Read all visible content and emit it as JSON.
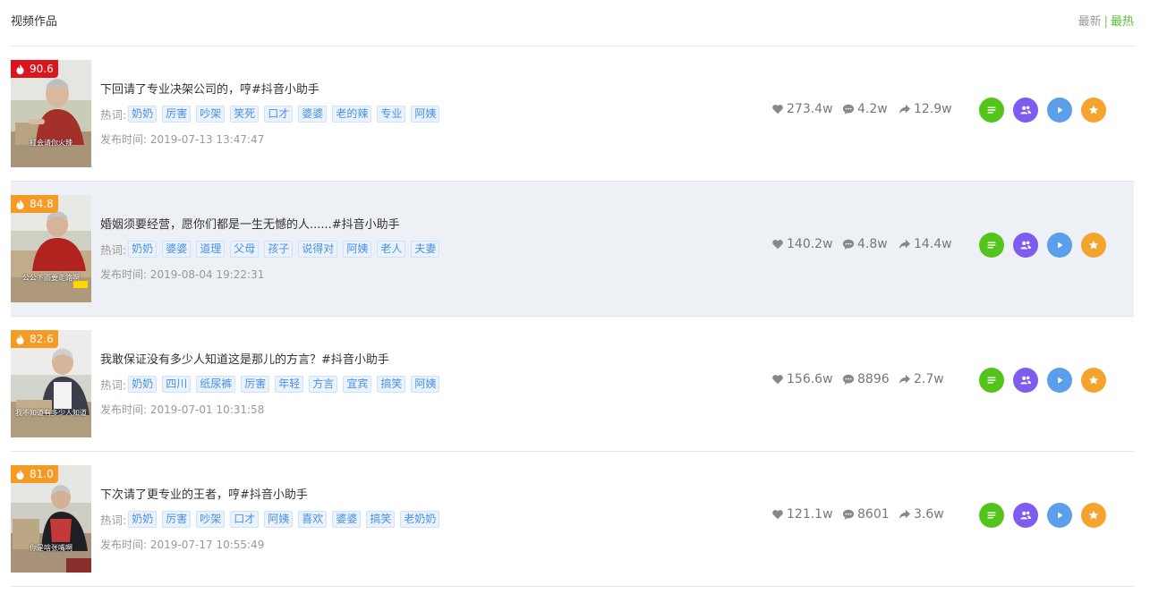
{
  "header": {
    "title": "视频作品",
    "sort_newest": "最新",
    "sort_separator": "|",
    "sort_hottest": "最热"
  },
  "tags_label": "热词:",
  "time_label": "发布时间:",
  "colors": {
    "badge_red": "#d9161e",
    "badge_orange": "#f59a23",
    "active_sort": "#5cba2d",
    "tag_text": "#4a90e2"
  },
  "videos": [
    {
      "score": "90.6",
      "title": "下回请了专业决架公司的，哼#抖音小助手",
      "tags": [
        "奶奶",
        "厉害",
        "吵架",
        "笑死",
        "口才",
        "婆婆",
        "老的辣",
        "专业",
        "阿姨"
      ],
      "time": "2019-07-13 13:47:47",
      "likes": "273.4w",
      "comments": "4.2w",
      "shares": "12.9w",
      "thumb_caption": "打会请你火辣"
    },
    {
      "score": "84.8",
      "title": "婚姻须要经营，愿你们都是一生无憾的人......#抖音小助手",
      "tags": [
        "奶奶",
        "婆婆",
        "道理",
        "父母",
        "孩子",
        "说得对",
        "阿姨",
        "老人",
        "夫妻"
      ],
      "time": "2019-08-04 19:22:31",
      "likes": "140.2w",
      "comments": "4.8w",
      "shares": "14.4w",
      "thumb_caption": "公公下雨要走路啊"
    },
    {
      "score": "82.6",
      "title": "我敢保证没有多少人知道这是那儿的方言？#抖音小助手",
      "tags": [
        "奶奶",
        "四川",
        "纸尿裤",
        "厉害",
        "年轻",
        "方言",
        "宜宾",
        "搞笑",
        "阿姨"
      ],
      "time": "2019-07-01 10:31:58",
      "likes": "156.6w",
      "comments": "8896",
      "shares": "2.7w",
      "thumb_caption": "我不知道有多少人知道"
    },
    {
      "score": "81.0",
      "title": "下次请了更专业的王者，哼#抖音小助手",
      "tags": [
        "奶奶",
        "厉害",
        "吵架",
        "口才",
        "阿姨",
        "喜欢",
        "婆婆",
        "搞笑",
        "老奶奶"
      ],
      "time": "2019-07-17 10:55:49",
      "likes": "121.1w",
      "comments": "8601",
      "shares": "3.6w",
      "thumb_caption": "你是啥张嘴啊"
    }
  ]
}
